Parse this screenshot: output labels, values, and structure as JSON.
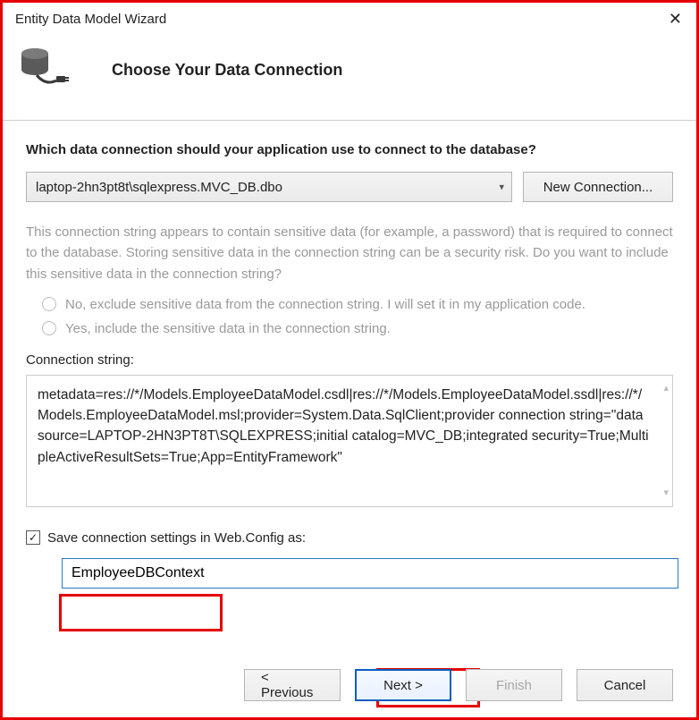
{
  "window": {
    "title": "Entity Data Model Wizard"
  },
  "header": {
    "title": "Choose Your Data Connection"
  },
  "question": "Which data connection should your application use to connect to the database?",
  "dropdown": {
    "selected": "laptop-2hn3pt8t\\sqlexpress.MVC_DB.dbo"
  },
  "newConnection": {
    "label": "New Connection..."
  },
  "sensitiveNote": "This connection string appears to contain sensitive data (for example, a password) that is required to connect to the database. Storing sensitive data in the connection string can be a security risk. Do you want to include this sensitive data in the connection string?",
  "radios": {
    "exclude": "No, exclude sensitive data from the connection string. I will set it in my application code.",
    "include": "Yes, include the sensitive data in the connection string."
  },
  "csLabel": "Connection string:",
  "connectionString": "metadata=res://*/Models.EmployeeDataModel.csdl|res://*/Models.EmployeeDataModel.ssdl|res://*/Models.EmployeeDataModel.msl;provider=System.Data.SqlClient;provider connection string=\"data source=LAPTOP-2HN3PT8T\\SQLEXPRESS;initial catalog=MVC_DB;integrated security=True;MultipleActiveResultSets=True;App=EntityFramework\"",
  "saveCheckbox": {
    "checked": true,
    "label": "Save connection settings in Web.Config as:"
  },
  "contextName": "EmployeeDBContext",
  "buttons": {
    "previous": "< Previous",
    "next": "Next >",
    "finish": "Finish",
    "cancel": "Cancel"
  }
}
